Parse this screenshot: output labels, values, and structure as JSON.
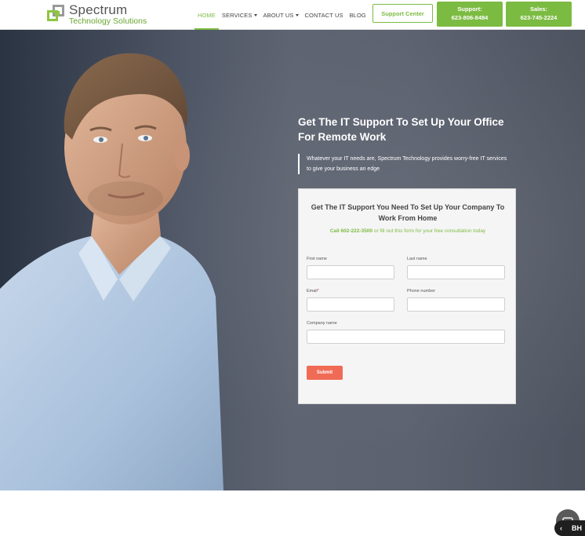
{
  "brand": {
    "name": "Spectrum",
    "tagline": "Technology Solutions"
  },
  "nav": {
    "items": [
      {
        "label": "HOME",
        "active": true,
        "dropdown": false
      },
      {
        "label": "SERVICES",
        "active": false,
        "dropdown": true
      },
      {
        "label": "ABOUT US",
        "active": false,
        "dropdown": true
      },
      {
        "label": "CONTACT US",
        "active": false,
        "dropdown": false
      },
      {
        "label": "BLOG",
        "active": false,
        "dropdown": false
      }
    ],
    "support_center_label": "Support Center",
    "support": {
      "label": "Support:",
      "phone": "623-806-8484"
    },
    "sales": {
      "label": "Sales:",
      "phone": "623-745-2224"
    }
  },
  "hero": {
    "title": "Get The IT Support To Set Up Your Office For Remote Work",
    "quote": "Whatever your IT needs are, Spectrum Technology provides worry-free IT services to give your business an edge"
  },
  "form": {
    "title": "Get The IT Support You Need To Set Up Your Company To Work From Home",
    "call_text": "Call 602-222-3500",
    "sub_text": " or fill out this form for your free consultation today",
    "fields": {
      "first_name": {
        "label": "First name",
        "value": ""
      },
      "last_name": {
        "label": "Last name",
        "value": ""
      },
      "email": {
        "label": "Email",
        "required_mark": "*",
        "value": ""
      },
      "phone": {
        "label": "Phone number",
        "value": ""
      },
      "company": {
        "label": "Company name",
        "value": ""
      }
    },
    "submit_label": "Submit"
  },
  "widgets": {
    "badge_label": "BH"
  },
  "colors": {
    "accent": "#7cbb42",
    "submit": "#f06b55",
    "hero_bg": "#5e6471"
  }
}
